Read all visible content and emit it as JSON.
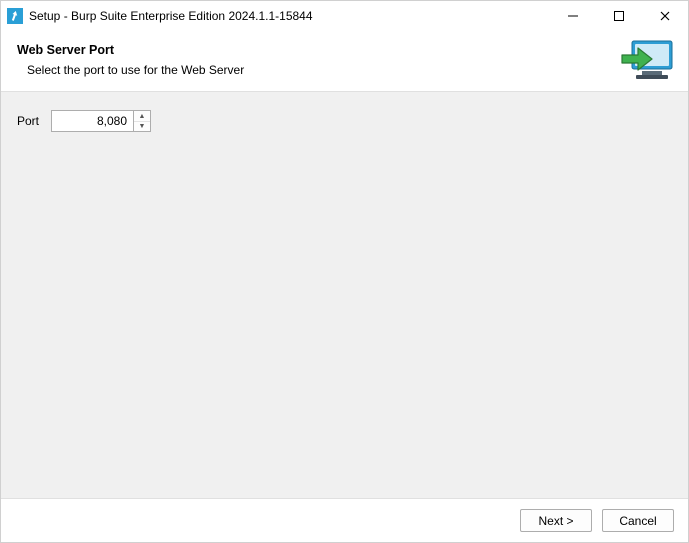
{
  "titlebar": {
    "text": "Setup - Burp Suite Enterprise Edition 2024.1.1-15844"
  },
  "header": {
    "heading": "Web Server Port",
    "subheading": "Select the port to use for the Web Server"
  },
  "form": {
    "port_label": "Port",
    "port_value": "8,080"
  },
  "footer": {
    "next_label": "Next >",
    "cancel_label": "Cancel"
  }
}
